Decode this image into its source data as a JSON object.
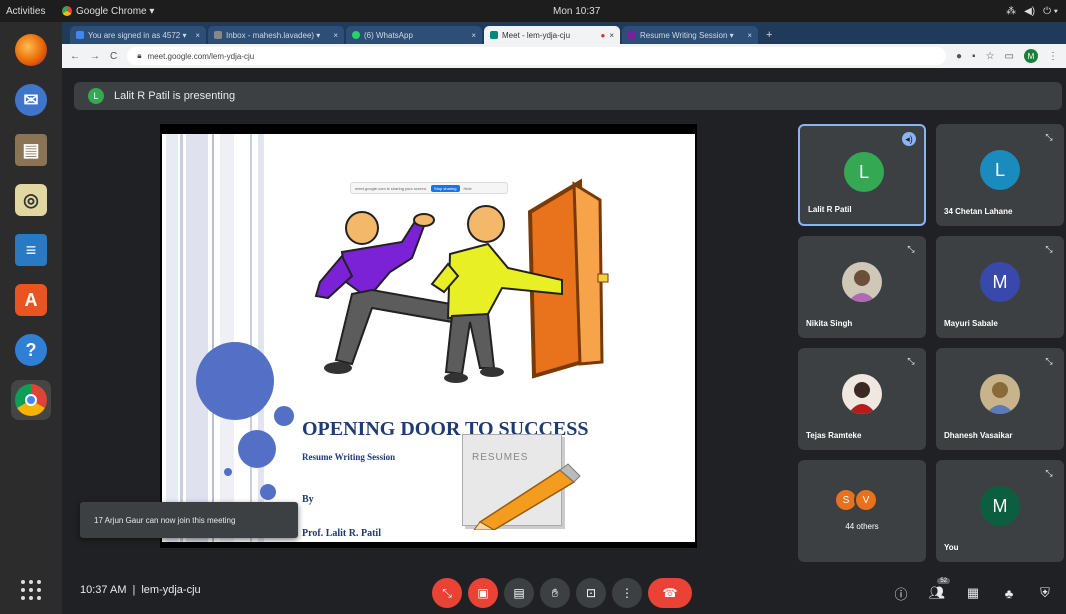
{
  "os": {
    "activities": "Activities",
    "app_name": "Google Chrome ▾",
    "clock": "Mon 10:37",
    "tray": [
      "⁂",
      "◀)",
      "⏻ ▾"
    ]
  },
  "dock": {
    "items": [
      {
        "name": "firefox-icon",
        "glyph": "",
        "color": "#e66000"
      },
      {
        "name": "thunderbird-icon",
        "glyph": "✉",
        "color": "#3f76c9"
      },
      {
        "name": "files-icon",
        "glyph": "▤",
        "color": "#8b7355"
      },
      {
        "name": "rhythmbox-icon",
        "glyph": "◎",
        "color": "#e0b500"
      },
      {
        "name": "writer-icon",
        "glyph": "≡",
        "color": "#2a7ac3"
      },
      {
        "name": "software-center-icon",
        "glyph": "A",
        "color": "#e95420"
      },
      {
        "name": "help-icon",
        "glyph": "?",
        "color": "#2f7fd6"
      },
      {
        "name": "chrome-icon",
        "glyph": "",
        "color": "#db4437"
      }
    ]
  },
  "browser": {
    "tabs": [
      {
        "label": "You are signed in as 4572 ▾",
        "color": "#4285f4",
        "active": false
      },
      {
        "label": "Inbox - mahesh.lavadee) ▾",
        "color": "#888888",
        "active": false
      },
      {
        "label": "(6) WhatsApp",
        "color": "#25d366",
        "active": false
      },
      {
        "label": "Meet - lem-ydja-cju",
        "color": "#00897b",
        "active": true
      },
      {
        "label": "Resume Writing Session ▾",
        "color": "#7b1fa2",
        "active": false
      }
    ],
    "new_tab": "+",
    "url": "meet.google.com/lem-ydja-cju",
    "profile_initial": "M"
  },
  "meet": {
    "presenting_initial": "L",
    "presenting_text": "Lalit R Patil is presenting",
    "share_notice": "meet.google.com is sharing your screen.",
    "share_stop": "Stop sharing",
    "share_hide": "Hide",
    "slide": {
      "title": "OPENING DOOR TO SUCCESS",
      "subtitle": "Resume Writing Session",
      "by": "By",
      "author": "Prof. Lalit R. Patil",
      "resume_label": "RESUMES"
    },
    "toast": "17 Arjun Gaur can now join this meeting",
    "tiles": [
      {
        "name": "Lalit R Patil",
        "initial": "L",
        "color": "#34a853",
        "speaking": true
      },
      {
        "name": "34 Chetan Lahane",
        "initial": "L",
        "color": "#1a8bbd",
        "speaking": false
      },
      {
        "name": "Nikita Singh",
        "initial": "",
        "color": "#6b4f3a",
        "speaking": false
      },
      {
        "name": "Mayuri Sabale",
        "initial": "M",
        "color": "#3949ab",
        "speaking": false
      },
      {
        "name": "Tejas Ramteke",
        "initial": "",
        "color": "#7a2020",
        "speaking": false
      },
      {
        "name": "Dhanesh Vasaikar",
        "initial": "",
        "color": "#8a6a3a",
        "speaking": false
      },
      {
        "name": "44 others",
        "initial": "",
        "color": "#e8711c",
        "speaking": false
      },
      {
        "name": "You",
        "initial": "M",
        "color": "#0b5e40",
        "speaking": false
      }
    ],
    "others_avatars": [
      "S",
      "V"
    ],
    "time": "10:37 AM",
    "separator": "|",
    "meeting_code": "lem-ydja-cju",
    "participants_count": "52"
  },
  "colors": {
    "end_call": "#ea4335",
    "tile_bg": "#3c4043",
    "speaking_border": "#8ab4f8"
  }
}
